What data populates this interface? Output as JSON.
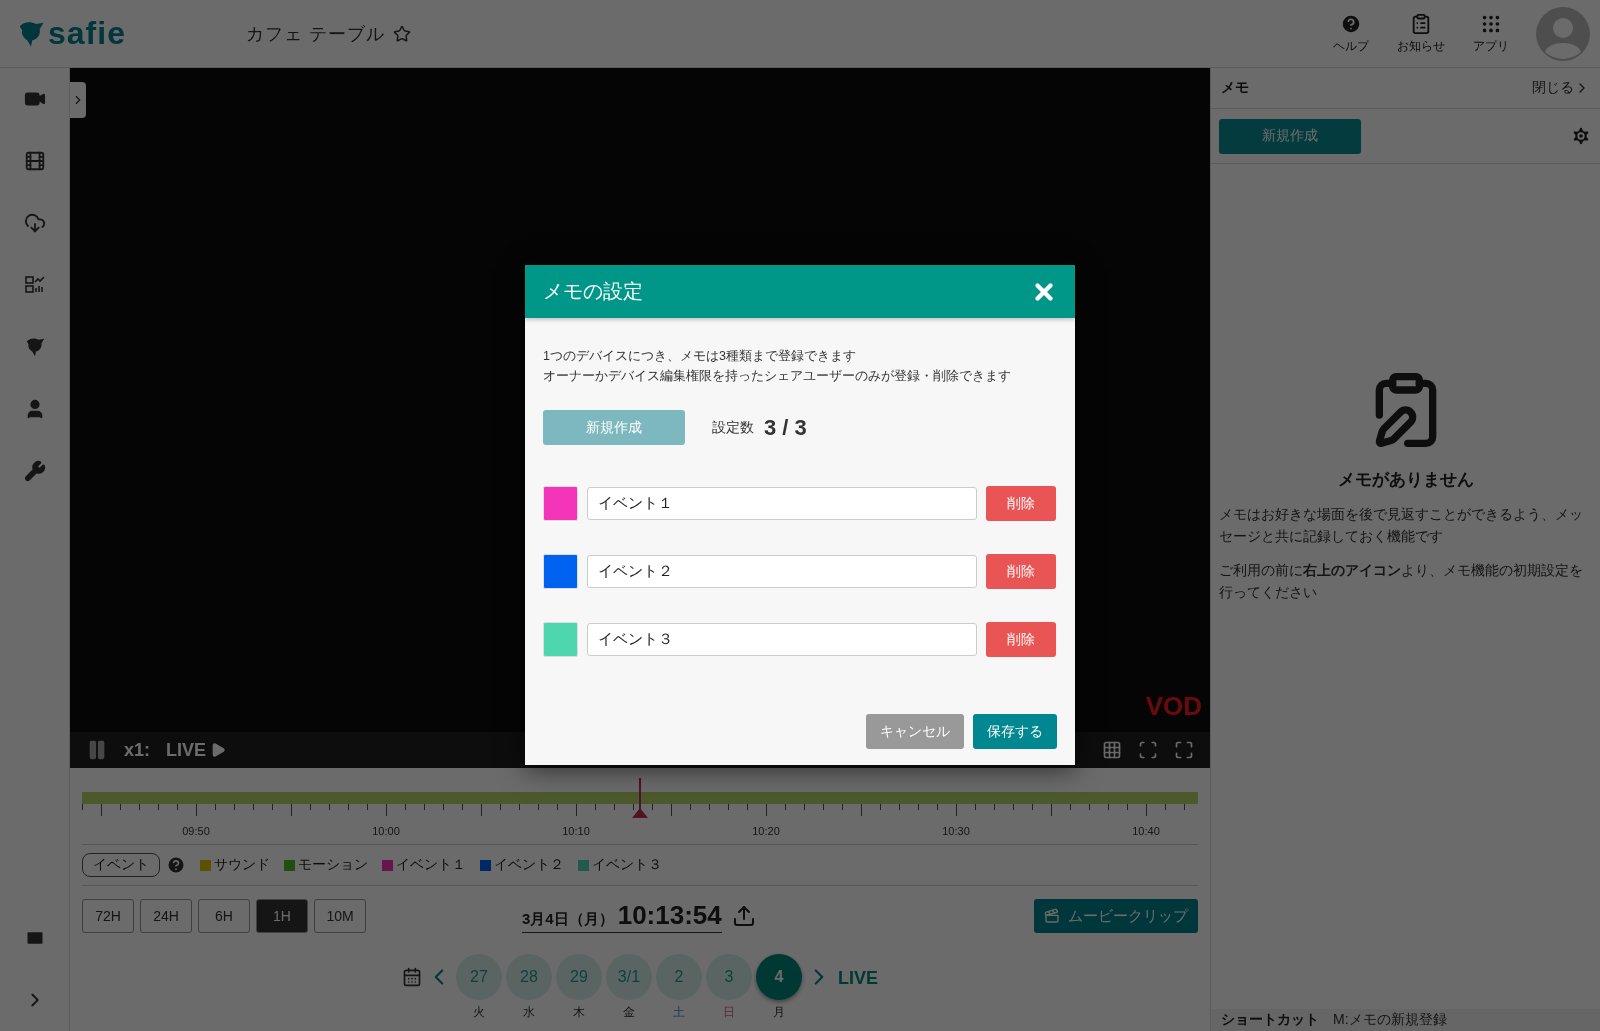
{
  "header": {
    "logo": "safie",
    "camera_name": "カフェ テーブル",
    "favorite": false,
    "nav": [
      {
        "kind": "help",
        "label": "ヘルプ"
      },
      {
        "kind": "news",
        "label": "お知らせ"
      },
      {
        "kind": "apps",
        "label": "アプリ"
      }
    ]
  },
  "player": {
    "speed": "x1:",
    "live": "LIVE",
    "badge": "VOD"
  },
  "timeline": {
    "ticks": [
      "09:50",
      "10:00",
      "10:10",
      "10:20",
      "10:30",
      "10:40"
    ]
  },
  "legend": {
    "button": "イベント",
    "items": [
      {
        "label": "サウンド",
        "color": "#5a5200"
      },
      {
        "label": "モーション",
        "color": "#244d14"
      },
      {
        "label": "イベント１",
        "color": "#66164d"
      },
      {
        "label": "イベント２",
        "color": "#002964"
      },
      {
        "label": "イベント３",
        "color": "#205a4a"
      }
    ]
  },
  "range_buttons": [
    {
      "label": "72H",
      "selected": false
    },
    {
      "label": "24H",
      "selected": false
    },
    {
      "label": "6H",
      "selected": false
    },
    {
      "label": "1H",
      "selected": true
    },
    {
      "label": "10M",
      "selected": false
    }
  ],
  "datetime": {
    "date": "3月4日（月）",
    "time": "10:13:54"
  },
  "movie_clip": "ムービークリップ",
  "days": [
    {
      "date": "27",
      "weekday": "火",
      "kind": "weekday",
      "selected": false
    },
    {
      "date": "28",
      "weekday": "水",
      "kind": "weekday",
      "selected": false
    },
    {
      "date": "29",
      "weekday": "木",
      "kind": "weekday",
      "selected": false
    },
    {
      "date": "3/1",
      "weekday": "金",
      "kind": "weekday",
      "selected": false
    },
    {
      "date": "2",
      "weekday": "土",
      "kind": "saturday",
      "selected": false
    },
    {
      "date": "3",
      "weekday": "日",
      "kind": "sunday",
      "selected": false
    },
    {
      "date": "4",
      "weekday": "月",
      "kind": "weekday",
      "selected": true
    }
  ],
  "live_link": "LIVE",
  "memo_panel": {
    "title": "メモ",
    "close": "閉じる",
    "new_button": "新規作成",
    "empty_title": "メモがありません",
    "descriptions": [
      "メモはお好きな場面を後で見返すことができるよう、メッセージと共に記録しておく機能です",
      "ご利用の前に**右上のアイコン**より、メモ機能の初期設定を行ってください"
    ],
    "shortcut_label": "ショートカット",
    "shortcut": "M:メモの新規登録"
  },
  "modal": {
    "title": "メモの設定",
    "notes": [
      "1つのデバイスにつき、メモは3種類まで登録できます",
      "オーナーかデバイス編集権限を持ったシェアユーザーのみが登録・削除できます"
    ],
    "new_button": {
      "label": "新規作成",
      "disabled": true
    },
    "count_label": "設定数",
    "count": "3 / 3",
    "events": [
      {
        "name": "イベント１",
        "color": "#f535b9",
        "delete": "削除"
      },
      {
        "name": "イベント２",
        "color": "#0062f0",
        "delete": "削除"
      },
      {
        "name": "イベント３",
        "color": "#4dd6b0",
        "delete": "削除"
      }
    ],
    "cancel": "キャンセル",
    "save": "保存する"
  }
}
